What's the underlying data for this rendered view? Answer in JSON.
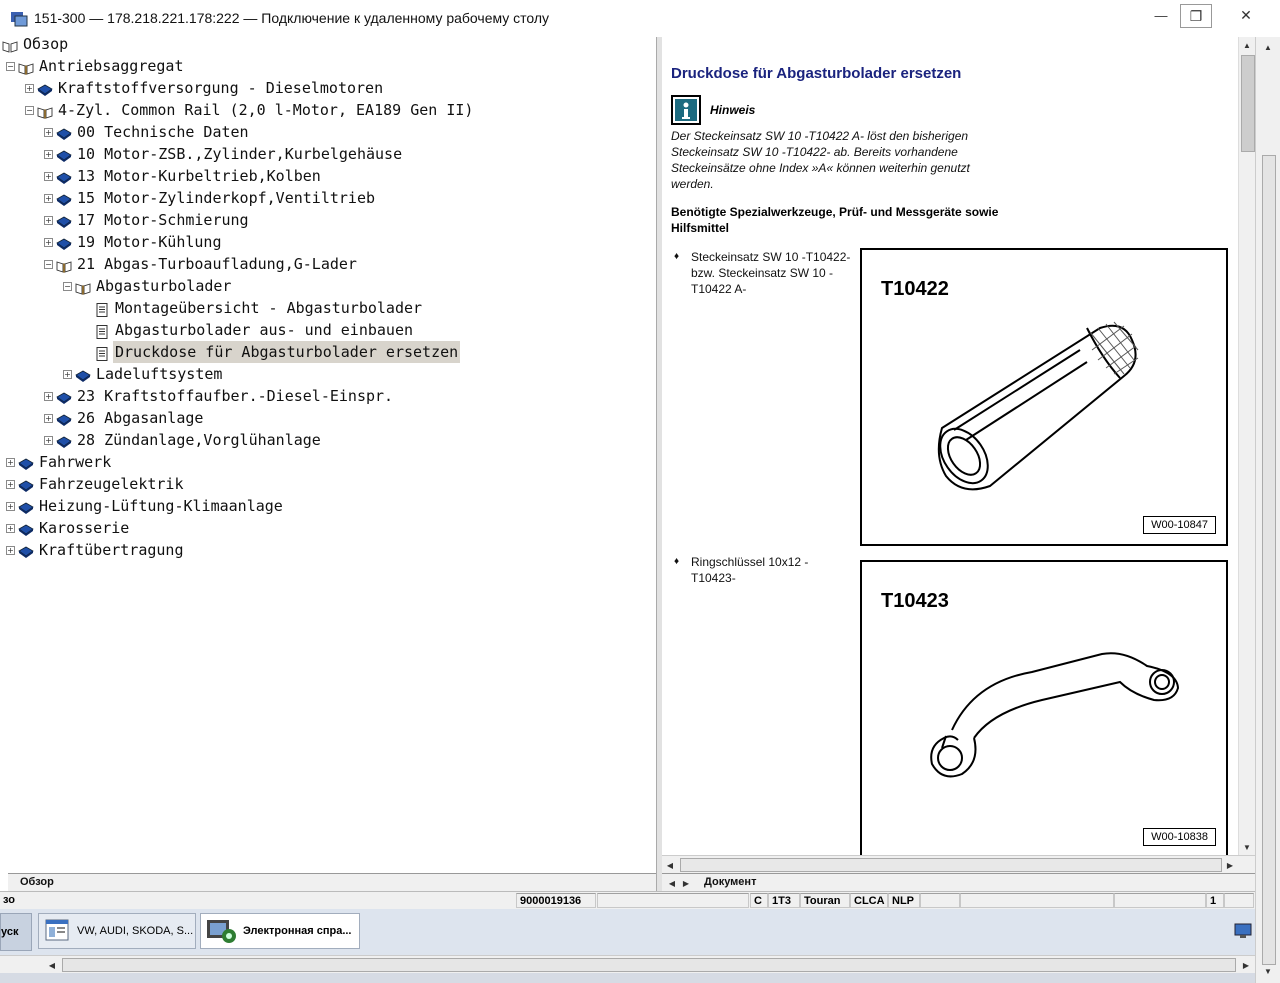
{
  "window": {
    "title": "151-300 — 178.218.221.178:222 — Подключение к удаленному рабочему столу",
    "minimize": "—",
    "restore": "❐",
    "close": "✕"
  },
  "tree": [
    {
      "label": "Обзор",
      "depth": 0,
      "icon": "root-book",
      "expander": "none"
    },
    {
      "label": "Antriebsaggregat",
      "depth": 1,
      "icon": "open-book",
      "expander": "minus"
    },
    {
      "label": "Kraftstoffversorgung - Dieselmotoren",
      "depth": 2,
      "icon": "closed-book",
      "expander": "plus"
    },
    {
      "label": "4-Zyl. Common Rail (2,0 l-Motor, EA189 Gen II)",
      "depth": 2,
      "icon": "open-book",
      "expander": "minus"
    },
    {
      "label": "00 Technische Daten",
      "depth": 3,
      "icon": "closed-book",
      "expander": "plus"
    },
    {
      "label": "10 Motor-ZSB.,Zylinder,Kurbelgehäuse",
      "depth": 3,
      "icon": "closed-book",
      "expander": "plus"
    },
    {
      "label": "13 Motor-Kurbeltrieb,Kolben",
      "depth": 3,
      "icon": "closed-book",
      "expander": "plus"
    },
    {
      "label": "15 Motor-Zylinderkopf,Ventiltrieb",
      "depth": 3,
      "icon": "closed-book",
      "expander": "plus"
    },
    {
      "label": "17 Motor-Schmierung",
      "depth": 3,
      "icon": "closed-book",
      "expander": "plus"
    },
    {
      "label": "19 Motor-Kühlung",
      "depth": 3,
      "icon": "closed-book",
      "expander": "plus"
    },
    {
      "label": "21 Abgas-Turboaufladung,G-Lader",
      "depth": 3,
      "icon": "open-book",
      "expander": "minus"
    },
    {
      "label": "Abgasturbolader",
      "depth": 4,
      "icon": "open-book",
      "expander": "minus"
    },
    {
      "label": "Montageübersicht - Abgasturbolader",
      "depth": 5,
      "icon": "page",
      "expander": "none"
    },
    {
      "label": "Abgasturbolader aus- und einbauen",
      "depth": 5,
      "icon": "page",
      "expander": "none"
    },
    {
      "label": "Druckdose für Abgasturbolader ersetzen",
      "depth": 5,
      "icon": "page",
      "expander": "none",
      "selected": true
    },
    {
      "label": "Ladeluftsystem",
      "depth": 4,
      "icon": "closed-book",
      "expander": "plus"
    },
    {
      "label": "23 Kraftstoffaufber.-Diesel-Einspr.",
      "depth": 3,
      "icon": "closed-book",
      "expander": "plus"
    },
    {
      "label": "26 Abgasanlage",
      "depth": 3,
      "icon": "closed-book",
      "expander": "plus"
    },
    {
      "label": "28 Zündanlage,Vorglühanlage",
      "depth": 3,
      "icon": "closed-book",
      "expander": "plus"
    },
    {
      "label": "Fahrwerk",
      "depth": 1,
      "icon": "closed-book",
      "expander": "plus"
    },
    {
      "label": "Fahrzeugelektrik",
      "depth": 1,
      "icon": "closed-book",
      "expander": "plus"
    },
    {
      "label": "Heizung-Lüftung-Klimaanlage",
      "depth": 1,
      "icon": "closed-book",
      "expander": "plus"
    },
    {
      "label": "Karosserie",
      "depth": 1,
      "icon": "closed-book",
      "expander": "plus"
    },
    {
      "label": "Kraftübertragung",
      "depth": 1,
      "icon": "closed-book",
      "expander": "plus"
    }
  ],
  "left_tab": "Обзор",
  "doc_tab": "Документ",
  "document": {
    "heading": "Druckdose für Abgasturbolader ersetzen",
    "note_title": "Hinweis",
    "note_text": "Der Steckeinsatz SW 10 -T10422 A- löst den bisherigen Steckeinsatz SW 10 -T10422- ab. Bereits vorhandene Steckeinsätze ohne Index »A« können weiterhin genutzt werden.",
    "section_title": "Benötigte Spezialwerkzeuge, Prüf- und Messgeräte sowie Hilfsmittel",
    "items": [
      {
        "text": "Steckeinsatz SW 10 -T10422- bzw. Steckeinsatz SW 10 -T10422 A-",
        "code": "T10422",
        "ref": "W00-10847"
      },
      {
        "text": "Ringschlüssel 10x12 -T10423-",
        "code": "T10423",
        "ref": "W00-10838"
      }
    ]
  },
  "status": {
    "left": "зо",
    "id": "9000019136",
    "c": "C",
    "model_code": "1T3",
    "model": "Touran",
    "engine": "CLCA",
    "lang": "NLP",
    "page": "1"
  },
  "taskbar": {
    "start": "уск",
    "btn1": "VW, AUDI, SKODA, S...",
    "btn2": "Электронная спра..."
  },
  "colors": {
    "heading": "#1a237e",
    "book": "#1f4fa8"
  }
}
